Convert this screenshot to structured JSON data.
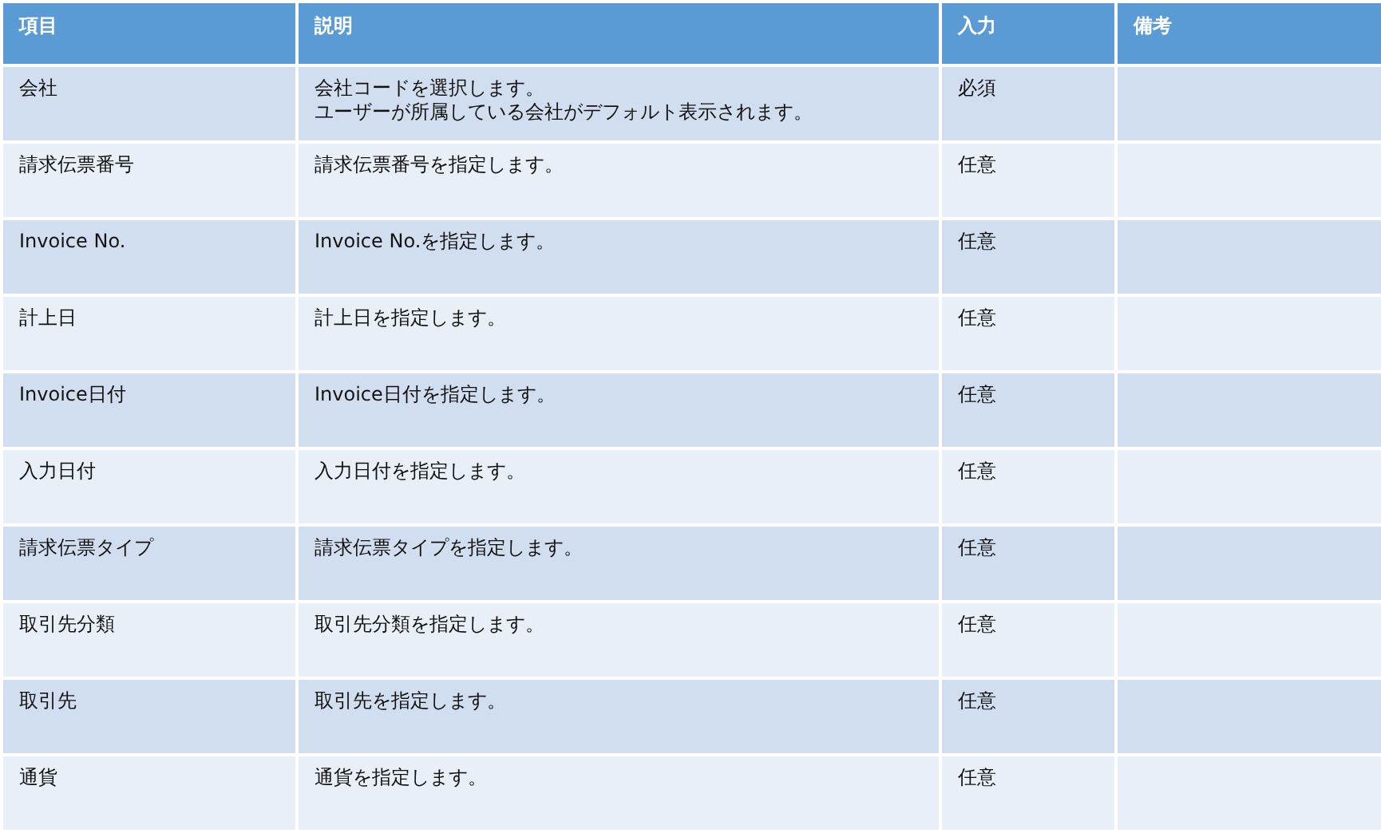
{
  "table": {
    "columns": [
      "項目",
      "説明",
      "入力",
      "備考"
    ],
    "rows": [
      {
        "item": "会社",
        "description": [
          "会社コードを選択します。",
          "ユーザーが所属している会社がデフォルト表示されます。"
        ],
        "input": "必須"
      },
      {
        "item": "請求伝票番号",
        "description": "請求伝票番号を指定します。",
        "input": "任意"
      },
      {
        "item": "Invoice No.",
        "description": "Invoice No.を指定します。",
        "input": "任意"
      },
      {
        "item": "計上日",
        "description": "計上日を指定します。",
        "input": "任意"
      },
      {
        "item": "Invoice日付",
        "description": "Invoice日付を指定します。",
        "input": "任意"
      },
      {
        "item": "入力日付",
        "description": "入力日付を指定します。",
        "input": "任意"
      },
      {
        "item": "請求伝票タイプ",
        "description": "請求伝票タイプを指定します。",
        "input": "任意"
      },
      {
        "item": "取引先分類",
        "description": "取引先分類を指定します。",
        "input": "任意"
      },
      {
        "item": "取引先",
        "description": "取引先を指定します。",
        "input": "任意"
      },
      {
        "item": "通貨",
        "description": "通貨を指定します。",
        "input": "任意"
      }
    ]
  }
}
